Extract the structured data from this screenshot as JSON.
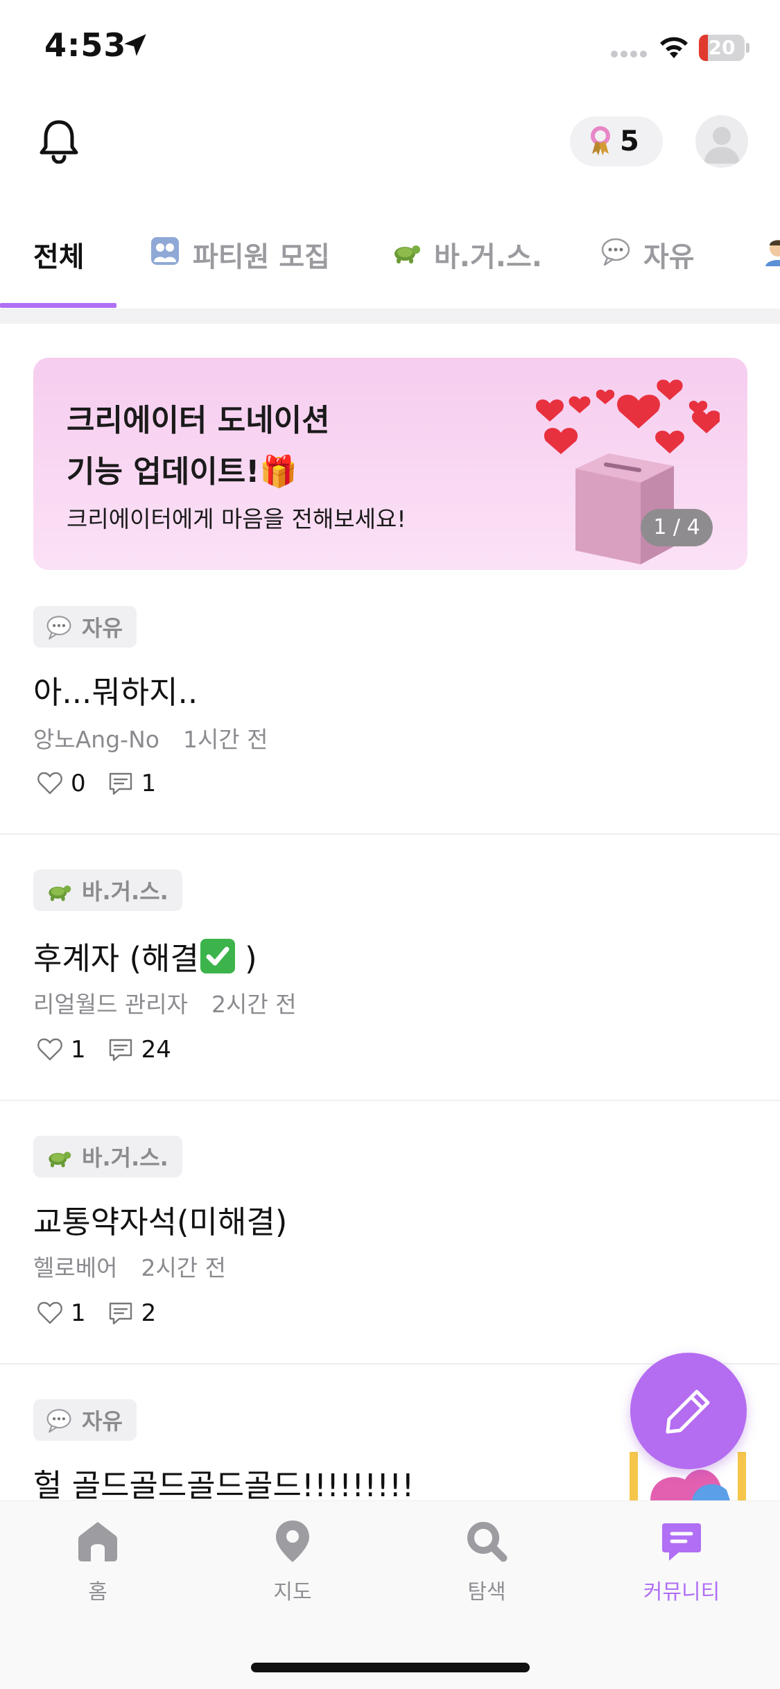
{
  "status_bar": {
    "time": "4:53",
    "battery_level": "20",
    "battery_fraction": 0.2,
    "icons": [
      "location-arrow-icon",
      "signal-icon",
      "wifi-icon",
      "battery-icon"
    ]
  },
  "header": {
    "bell_icon": "bell-icon",
    "points": "5",
    "points_icon": "ribbon-icon",
    "avatar_icon": "avatar-placeholder"
  },
  "tabs": [
    {
      "label": "전체",
      "active": true
    },
    {
      "label": "파티원 모집",
      "icon": "people-emoji"
    },
    {
      "label": "바.거.스.",
      "icon": "turtle-emoji"
    },
    {
      "label": "자유",
      "icon": "speech-bubble-emoji"
    },
    {
      "label": "",
      "icon": "person-emoji"
    }
  ],
  "banner": {
    "title_line1": "크리에이터 도네이션",
    "title_line2": "기능 업데이트!🎁",
    "subtitle": "크리에이터에게 마음을 전해보세요!",
    "counter": "1 / 4"
  },
  "posts": [
    {
      "tag": "자유",
      "tag_icon": "speech-bubble-emoji",
      "title": "아...뭐하지..",
      "author": "앙노Ang-No",
      "time": "1시간 전",
      "likes": "0",
      "comments": "1"
    },
    {
      "tag": "바.거.스.",
      "tag_icon": "turtle-emoji",
      "title_before": "후계자 (해결",
      "title_after": " )",
      "author": "리얼월드 관리자",
      "time": "2시간 전",
      "likes": "1",
      "comments": "24"
    },
    {
      "tag": "바.거.스.",
      "tag_icon": "turtle-emoji",
      "title": "교통약자석(미해결)",
      "author": "헬로베어",
      "time": "2시간 전",
      "likes": "1",
      "comments": "2"
    },
    {
      "tag": "자유",
      "tag_icon": "speech-bubble-emoji",
      "title": "헐 골드골드골드골드!!!!!!!!!"
    }
  ],
  "nav": [
    {
      "label": "홈",
      "icon": "home-icon"
    },
    {
      "label": "지도",
      "icon": "map-pin-icon"
    },
    {
      "label": "탐색",
      "icon": "search-icon"
    },
    {
      "label": "커뮤니티",
      "icon": "community-icon",
      "active": true
    }
  ],
  "colors": {
    "accent": "#b06ff5",
    "fab": "#b46cf0",
    "banner_bg": "#f6cdef",
    "battery_low": "#e0392f"
  }
}
